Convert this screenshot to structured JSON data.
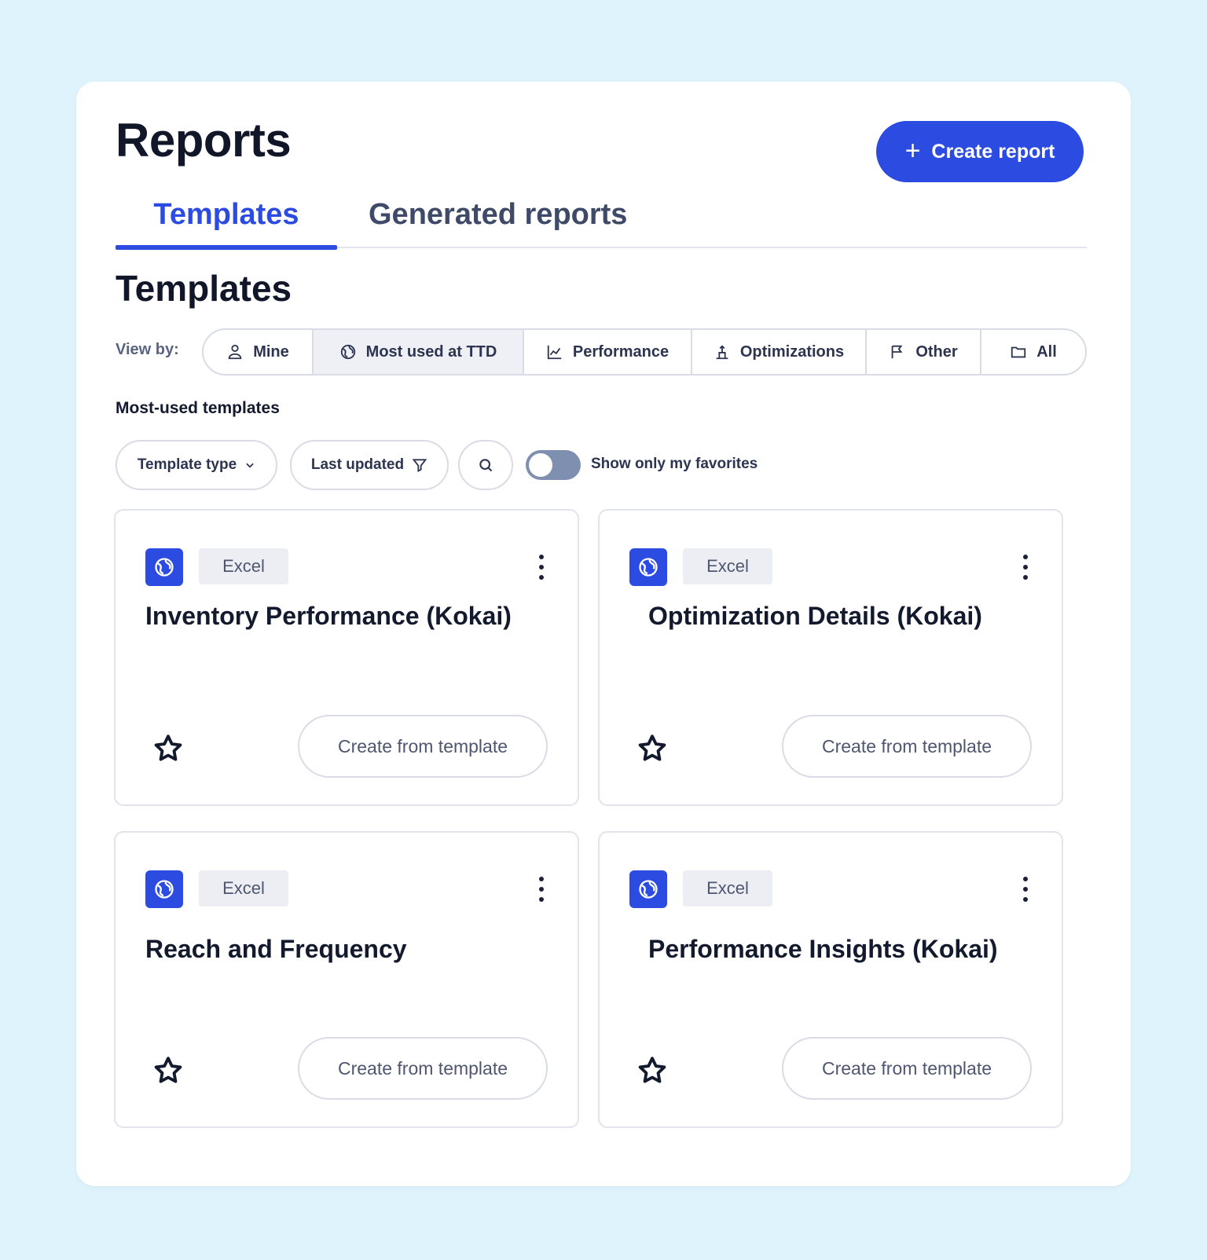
{
  "header": {
    "title": "Reports",
    "create_button_label": "Create report",
    "create_button_icon": "plus-icon"
  },
  "tabs": [
    {
      "label": "Templates",
      "active": true
    },
    {
      "label": "Generated reports",
      "active": false
    }
  ],
  "section_title": "Templates",
  "view_by": {
    "label": "View by:",
    "options": [
      {
        "label": "Mine",
        "icon": "person-icon",
        "active": false
      },
      {
        "label": "Most used at TTD",
        "icon": "globe-icon",
        "active": true
      },
      {
        "label": "Performance",
        "icon": "line-chart-icon",
        "active": false
      },
      {
        "label": "Optimizations",
        "icon": "optimize-icon",
        "active": false
      },
      {
        "label": "Other",
        "icon": "flag-icon",
        "active": false
      },
      {
        "label": "All",
        "icon": "folder-icon",
        "active": false
      }
    ]
  },
  "subheading": "Most-used templates",
  "filters": {
    "template_type": "Template type",
    "last_updated": "Last updated",
    "search_icon": "search-icon",
    "favorites_toggle_label": "Show only my favorites",
    "favorites_toggle_on": false
  },
  "cards": [
    {
      "type": "Excel",
      "title": "Inventory Performance (Kokai)",
      "favorite": false,
      "action": "Create from template"
    },
    {
      "type": "Excel",
      "title": "Optimization Details (Kokai)",
      "favorite": false,
      "action": "Create from template"
    },
    {
      "type": "Excel",
      "title": "Reach and Frequency",
      "favorite": false,
      "action": "Create from template"
    },
    {
      "type": "Excel",
      "title": "Performance Insights (Kokai)",
      "favorite": false,
      "action": "Create from template"
    }
  ],
  "colors": {
    "background": "#dff3fd",
    "accent": "#2c4be0",
    "panel": "#ffffff"
  }
}
